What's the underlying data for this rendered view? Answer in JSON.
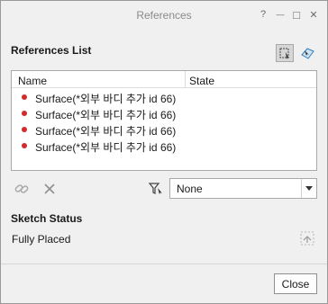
{
  "window": {
    "title": "References",
    "help_icon": "?",
    "minimize_icon": "—",
    "maximize_icon": "□",
    "close_icon": "✕"
  },
  "references_list": {
    "label": "References List",
    "columns": {
      "name": "Name",
      "state": "State"
    },
    "items": [
      {
        "name": "Surface(*외부 바디 추가 id 66)",
        "state": ""
      },
      {
        "name": "Surface(*외부 바디 추가 id 66)",
        "state": ""
      },
      {
        "name": "Surface(*외부 바디 추가 id 66)",
        "state": ""
      },
      {
        "name": "Surface(*외부 바디 추가 id 66)",
        "state": ""
      }
    ]
  },
  "filter": {
    "selected": "None"
  },
  "sketch_status": {
    "label": "Sketch Status",
    "value": "Fully Placed"
  },
  "footer": {
    "close_label": "Close"
  },
  "colors": {
    "error_dot": "#d22b2b",
    "accent": "#2f7fc1"
  }
}
